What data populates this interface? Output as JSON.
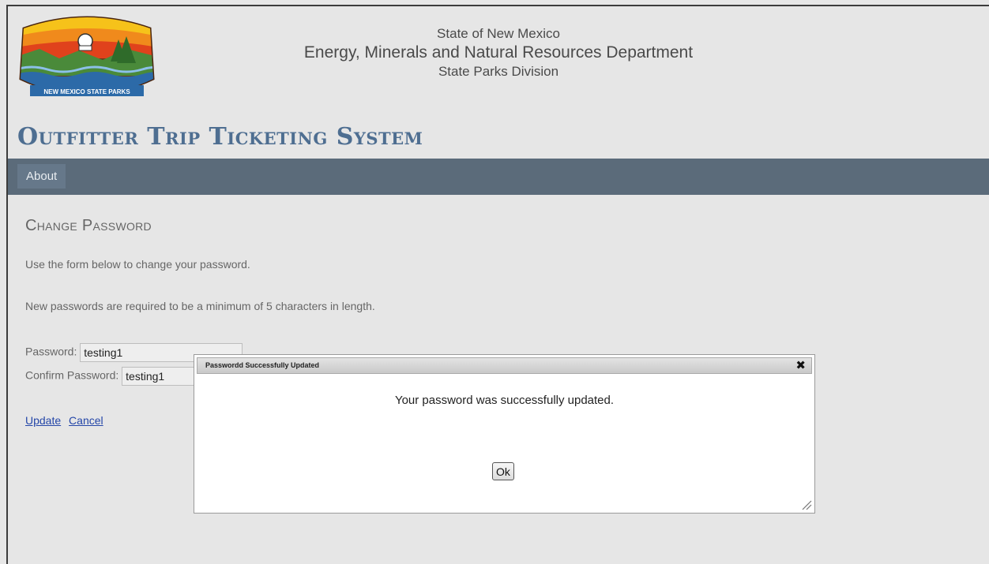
{
  "header": {
    "org_line1": "State of New Mexico",
    "org_line2": "Energy, Minerals and Natural Resources Department",
    "org_line3": "State Parks Division",
    "logo_text": "NEW MEXICO STATE PARKS",
    "app_title": "Outfitter Trip Ticketing System"
  },
  "nav": {
    "items": [
      {
        "label": "About"
      }
    ]
  },
  "page": {
    "title": "Change Password",
    "intro": "Use the form below to change your password.",
    "requirement": "New passwords are required to be a minimum of 5 characters in length.",
    "password_label": "Password:",
    "password_value": "testing1",
    "confirm_label": "Confirm Password:",
    "confirm_value": "testing1",
    "update_link": "Update",
    "cancel_link": "Cancel"
  },
  "modal": {
    "title": "Passwordd Successfully Updated",
    "close_icon": "close-icon",
    "message": "Your password was successfully updated.",
    "ok_label": "Ok"
  },
  "colors": {
    "app_title": "#4e6e91",
    "navbar": "#5b6b7a",
    "link": "#2446a8",
    "background": "#e6e6e6"
  }
}
